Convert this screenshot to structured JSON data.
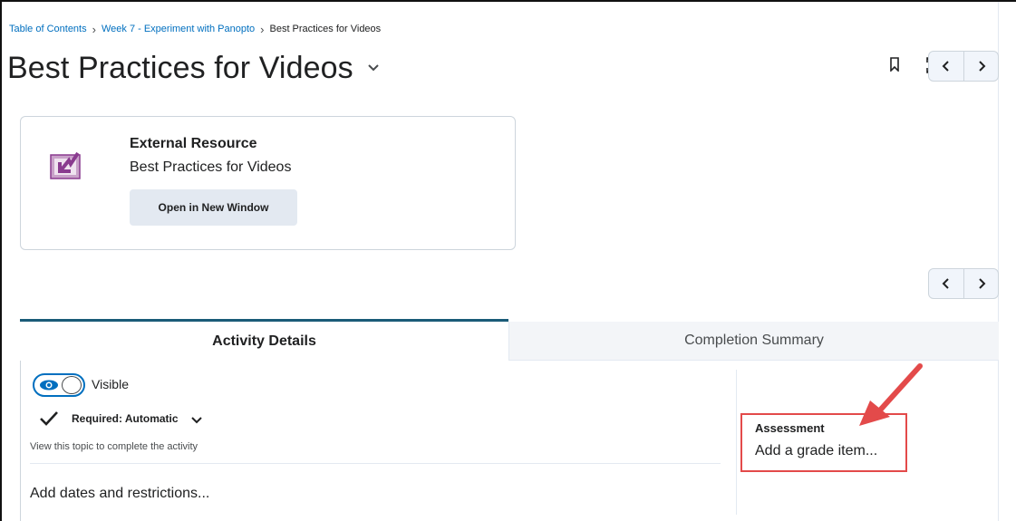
{
  "breadcrumb": {
    "items": [
      "Table of Contents",
      "Week 7 - Experiment with Panopto"
    ],
    "current": "Best Practices for Videos",
    "separator": "›"
  },
  "page": {
    "title": "Best Practices for Videos"
  },
  "toolbar": {
    "bookmark_icon": "bookmark-icon",
    "fullscreen_icon": "fullscreen-icon",
    "prev_icon": "chevron-left-icon",
    "next_icon": "chevron-right-icon"
  },
  "resource": {
    "type": "External Resource",
    "name": "Best Practices for Videos",
    "open_label": "Open in New Window",
    "icon": "external-link-icon",
    "icon_color": "#8a3b8f"
  },
  "tabs": {
    "activity_details": "Activity Details",
    "completion_summary": "Completion Summary",
    "active_color": "#1a5b78"
  },
  "details": {
    "visibility_label": "Visible",
    "required_label": "Required: Automatic",
    "completion_hint": "View this topic to complete the activity",
    "add_dates_label": "Add dates and restrictions..."
  },
  "assessment": {
    "label": "Assessment",
    "grade_link": "Add a grade item...",
    "highlight_color": "#e34a4a"
  }
}
